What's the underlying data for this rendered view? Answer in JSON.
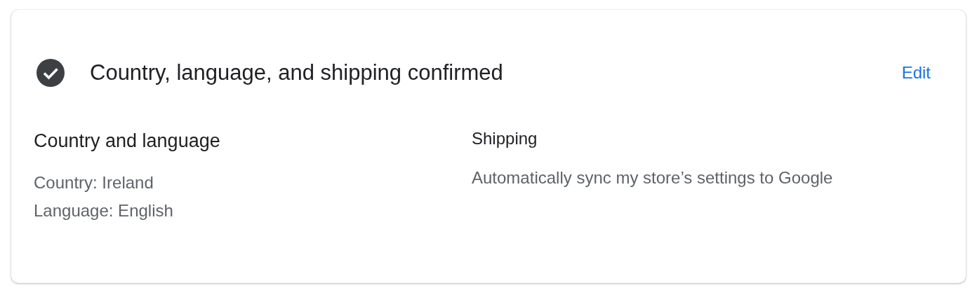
{
  "header": {
    "completed": true,
    "title": "Country, language, and shipping confirmed",
    "edit_link": "Edit"
  },
  "sections": [
    {
      "heading": "Country and language",
      "lines": [
        "Country: Ireland",
        "Language: English"
      ]
    },
    {
      "heading": "Shipping",
      "lines": [
        "Automatically sync my store’s settings to Google"
      ]
    }
  ]
}
